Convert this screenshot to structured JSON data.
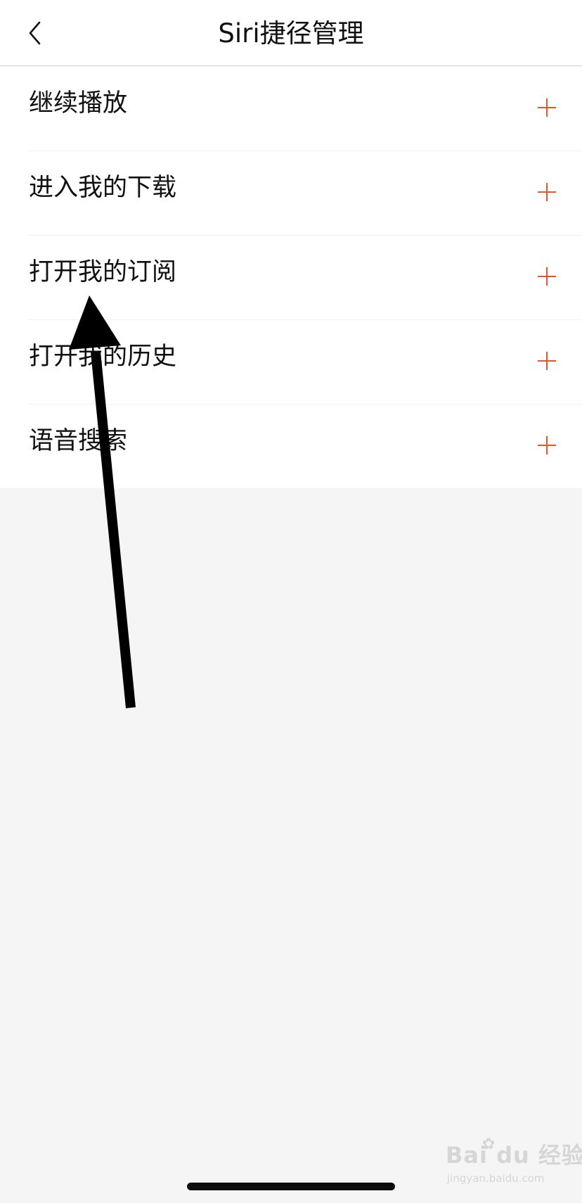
{
  "header": {
    "title": "Siri捷径管理",
    "back_icon": "chevron-left-icon"
  },
  "shortcuts": [
    {
      "label": "继续播放",
      "action_icon": "plus-icon"
    },
    {
      "label": "进入我的下载",
      "action_icon": "plus-icon"
    },
    {
      "label": "打开我的订阅",
      "action_icon": "plus-icon"
    },
    {
      "label": "打开我的历史",
      "action_icon": "plus-icon"
    },
    {
      "label": "语音搜索",
      "action_icon": "plus-icon"
    }
  ],
  "colors": {
    "accent": "#e8542e",
    "background": "#f5f5f5",
    "list_background": "#ffffff",
    "annotation_arrow": "#000000"
  },
  "watermark": {
    "text": "Bai du 经验",
    "subtext": "jingyan.baidu.com"
  }
}
